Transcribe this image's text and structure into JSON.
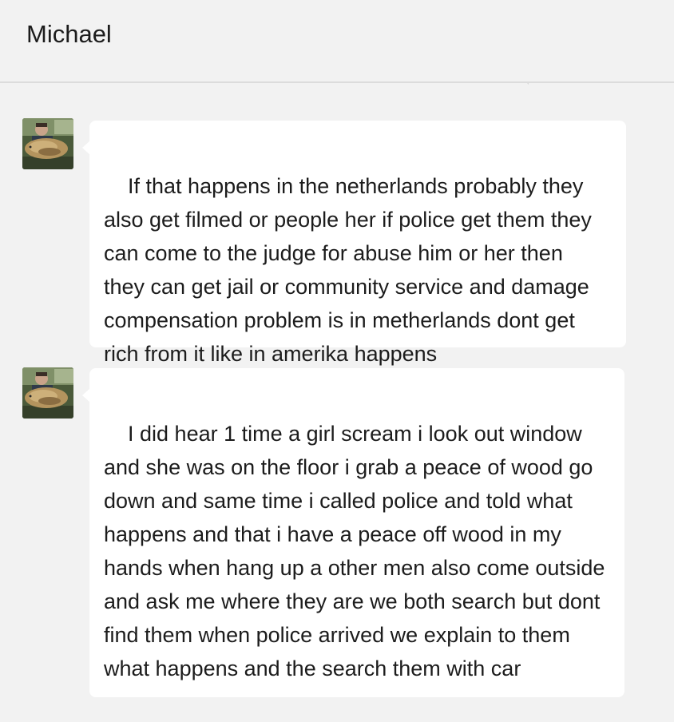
{
  "header": {
    "title": "Michael"
  },
  "messages": [
    {
      "avatar_icon": "user-avatar-icon",
      "text": "If that happens in the netherlands probably they also get filmed or people her if police get them they can come to the judge for abuse him or her then  they can get jail or community service and damage compensation problem is in metherlands dont get rich from it like in amerika happens"
    },
    {
      "avatar_icon": "user-avatar-icon",
      "text": "I did hear 1 time a girl scream i look out window and she was on the floor i grab a peace of wood go down and same time i called police and told what happens and that i have a peace off wood in my hands when hang up a other men also come outside and ask me where they are we both search but dont find them when police arrived we explain to them what happens and the search them with car"
    }
  ]
}
